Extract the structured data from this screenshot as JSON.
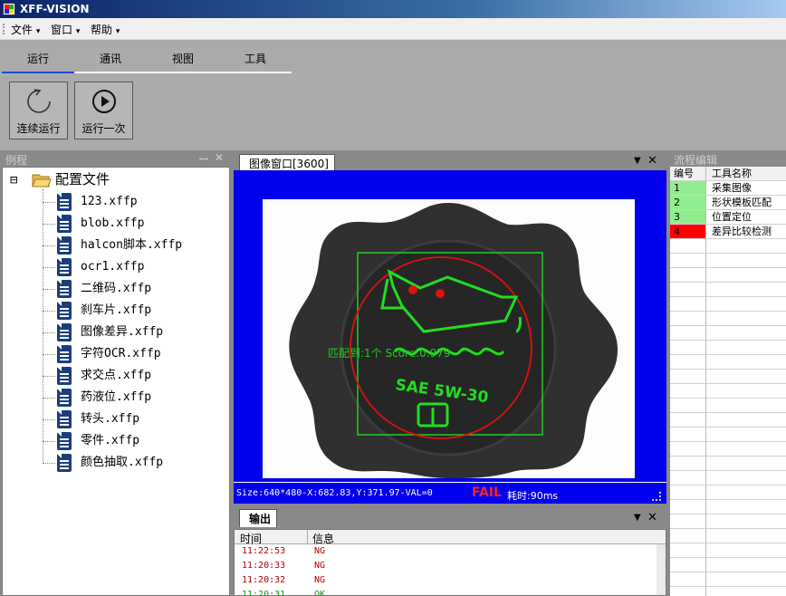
{
  "window": {
    "title": "XFF-VISION"
  },
  "menu": [
    {
      "label": "文件",
      "arrow": "▾"
    },
    {
      "label": "窗口",
      "arrow": "▾"
    },
    {
      "label": "帮助",
      "arrow": "▾"
    }
  ],
  "ribbon": {
    "tabs": [
      {
        "label": "运行",
        "active": true
      },
      {
        "label": "通讯"
      },
      {
        "label": "视图"
      },
      {
        "label": "工具"
      }
    ],
    "buttons": [
      {
        "label": "连续运行",
        "icon": "refresh-icon"
      },
      {
        "label": "运行一次",
        "icon": "play-icon"
      }
    ]
  },
  "left_panel": {
    "title": "例程",
    "pin": "ꟷ",
    "close": "✕",
    "tree": {
      "root": {
        "label": "配置文件",
        "expander": "⊟"
      },
      "files": [
        "123.xffp",
        "blob.xffp",
        "halcon脚本.xffp",
        "ocr1.xffp",
        "二维码.xffp",
        "刹车片.xffp",
        "图像差异.xffp",
        "字符OCR.xffp",
        "求交点.xffp",
        "药液位.xffp",
        "转头.xffp",
        "零件.xffp",
        "颜色抽取.xffp"
      ]
    }
  },
  "image_window": {
    "tab_label": "图像窗口[3600]",
    "menu_arrow": "▼",
    "close": "✕",
    "overlay": {
      "match_text": "匹配到:1个 Score:0.979",
      "cap_text_1": "SAE 5W-30"
    },
    "status": {
      "info": "Size:640*480-X:682.83,Y:371.97-VAL=0",
      "result": "FAIL",
      "time": "耗时:90ms"
    },
    "colors": {
      "background": "#0000ee",
      "fail": "#ff2020",
      "roi": "#22cc22",
      "circle": "#dd1111"
    }
  },
  "output": {
    "tab_label": "输出",
    "menu_arrow": "▼",
    "close": "✕",
    "columns": [
      "时间",
      "信息"
    ],
    "rows": [
      {
        "time": "11:22:53",
        "msg": "NG"
      },
      {
        "time": "11:20:33",
        "msg": "NG"
      },
      {
        "time": "11:20:32",
        "msg": "NG"
      },
      {
        "time": "11:20:31",
        "msg": "OK"
      }
    ]
  },
  "flow_editor": {
    "title": "流程编辑",
    "columns": [
      "编号",
      "工具名称"
    ],
    "rows": [
      {
        "id": "1",
        "name": "采集图像",
        "color": "#90ee90"
      },
      {
        "id": "2",
        "name": "形状模板匹配",
        "color": "#90ee90"
      },
      {
        "id": "3",
        "name": "位置定位",
        "color": "#90ee90"
      },
      {
        "id": "4",
        "name": "差异比较检测",
        "color": "#ff0000"
      }
    ]
  }
}
